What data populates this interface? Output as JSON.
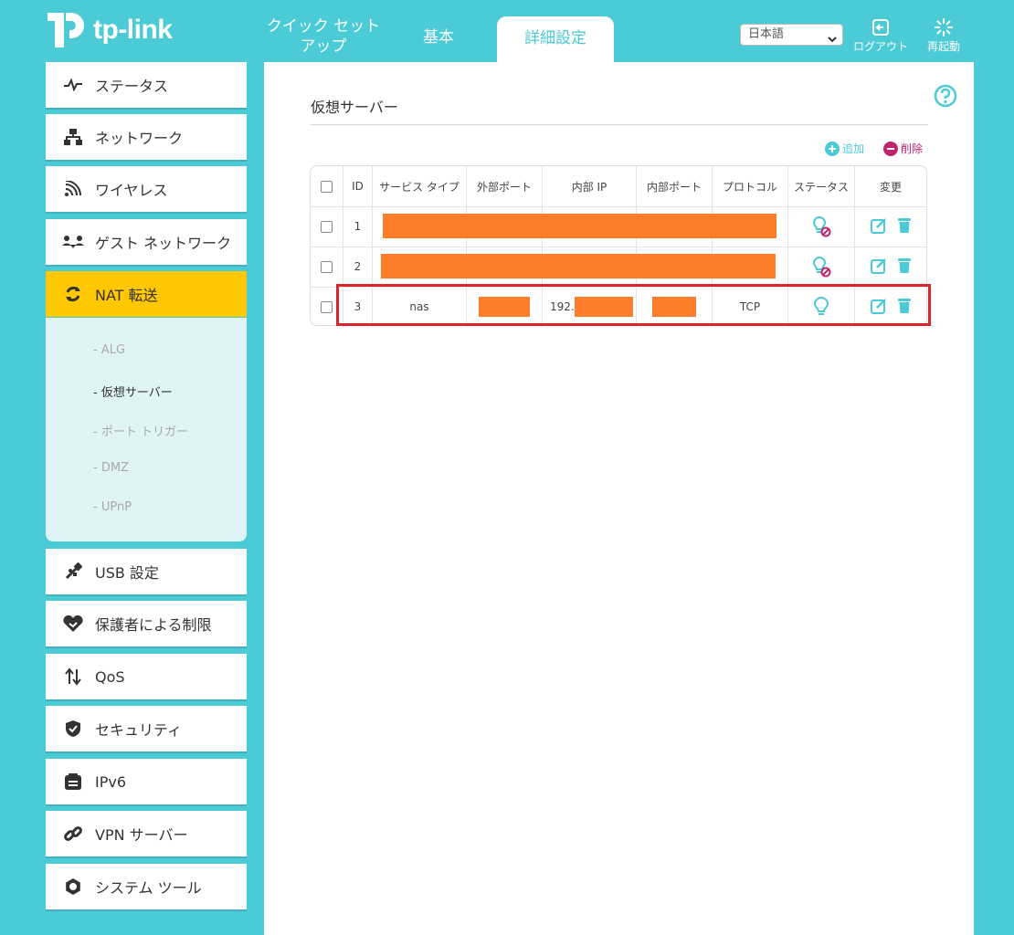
{
  "header": {
    "logo_text": "tp-link",
    "tabs": [
      {
        "label_line1": "クイック セット",
        "label_line2": "アップ"
      },
      {
        "label": "基本"
      },
      {
        "label": "詳細設定"
      }
    ],
    "language": "日本語",
    "logout_label": "ログアウト",
    "reboot_label": "再起動"
  },
  "sidebar": {
    "items": [
      {
        "label": "ステータス",
        "icon": "pulse-icon"
      },
      {
        "label": "ネットワーク",
        "icon": "network-icon"
      },
      {
        "label": "ワイヤレス",
        "icon": "wireless-icon"
      },
      {
        "label": "ゲスト ネットワーク",
        "icon": "guest-network-icon"
      },
      {
        "label": "NAT 転送",
        "icon": "nat-forwarding-icon"
      },
      {
        "label": "USB 設定",
        "icon": "usb-icon"
      },
      {
        "label": "保護者による制限",
        "icon": "parental-control-icon"
      },
      {
        "label": "QoS",
        "icon": "qos-icon"
      },
      {
        "label": "セキュリティ",
        "icon": "shield-icon"
      },
      {
        "label": "IPv6",
        "icon": "ipv6-icon"
      },
      {
        "label": "VPN サーバー",
        "icon": "vpn-link-icon"
      },
      {
        "label": "システム ツール",
        "icon": "gear-icon"
      }
    ],
    "submenu": [
      "ALG",
      "仮想サーバー",
      "ポート トリガー",
      "DMZ",
      "UPnP"
    ],
    "active_color": "#ffc800"
  },
  "main": {
    "title": "仮想サーバー",
    "add_label": "追加",
    "delete_label": "削除",
    "table": {
      "headers": [
        "ID",
        "サービス タイプ",
        "外部ポート",
        "内部 IP",
        "内部ポート",
        "プロトコル",
        "ステータス",
        "変更"
      ],
      "rows": [
        {
          "id": "1",
          "service": "",
          "ext_port": "",
          "int_ip": "",
          "int_port": "",
          "protocol": "",
          "status": "disabled"
        },
        {
          "id": "2",
          "service": "",
          "ext_port": "",
          "int_ip": "",
          "int_port": "",
          "protocol": "",
          "status": "disabled"
        },
        {
          "id": "3",
          "service": "nas",
          "ext_port": "",
          "int_ip": "192.",
          "int_port": "",
          "protocol": "TCP",
          "status": "enabled"
        }
      ]
    }
  },
  "colors": {
    "brand": "#4acbd6",
    "redaction": "#fd7e2a",
    "highlight": "#d9252b",
    "delete": "#c0246e"
  }
}
